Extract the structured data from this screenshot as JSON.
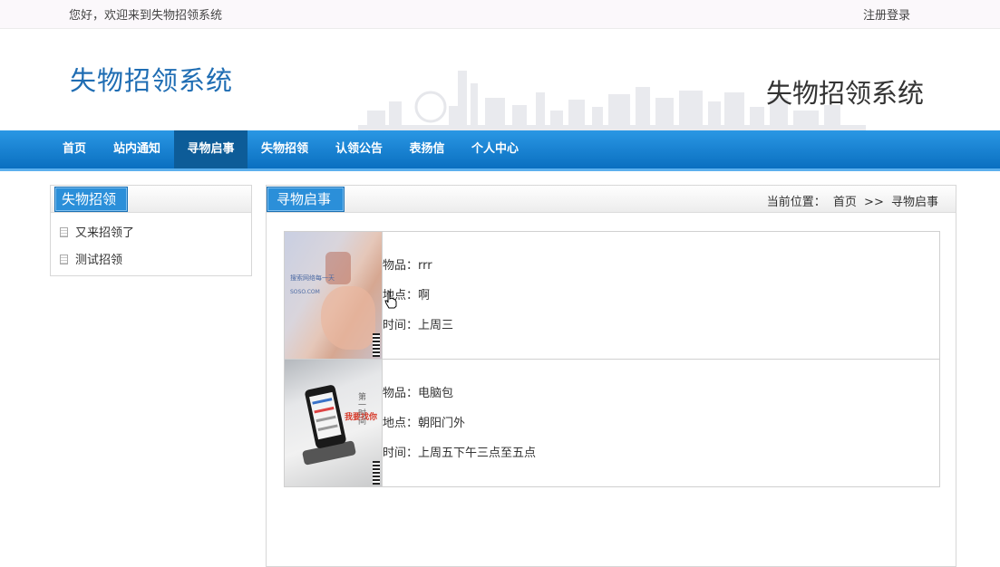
{
  "topbar": {
    "welcome": "您好，欢迎来到失物招领系统",
    "login": "注册登录"
  },
  "header": {
    "logo_text": "失物招领系统",
    "right_title": "失物招领系统"
  },
  "nav": {
    "items": [
      "首页",
      "站内通知",
      "寻物启事",
      "失物招领",
      "认领公告",
      "表扬信",
      "个人中心"
    ],
    "active": "寻物启事"
  },
  "sidebar": {
    "title": "失物招领",
    "items": [
      "又来招领了",
      "测试招领"
    ]
  },
  "main": {
    "title": "寻物启事",
    "breadcrumb": {
      "label": "当前位置：",
      "home": "首页",
      "separator": ">>",
      "current": "寻物启事"
    },
    "items": [
      {
        "image_icon": "photo-hand-holding-phone",
        "image_text_1": "搜索网络每一天",
        "image_text_2": "SOSO.COM",
        "item": "物品：rrr",
        "place": "地点：啊",
        "time": "时间：上周三"
      },
      {
        "image_icon": "photo-smartphone-on-desk",
        "image_text_1": "我要找你",
        "image_text_2": "第一时间",
        "item": "物品：电脑包",
        "place": "地点：朝阳门外",
        "time": "时间：上周五下午三点至五点"
      }
    ]
  },
  "colors": {
    "nav_top": "#2a97e4",
    "nav_bottom": "#0a6fc0",
    "nav_active": "#0d5c98",
    "logo_blue": "#1f6db3",
    "tab_blue": "#2b8fd9"
  }
}
